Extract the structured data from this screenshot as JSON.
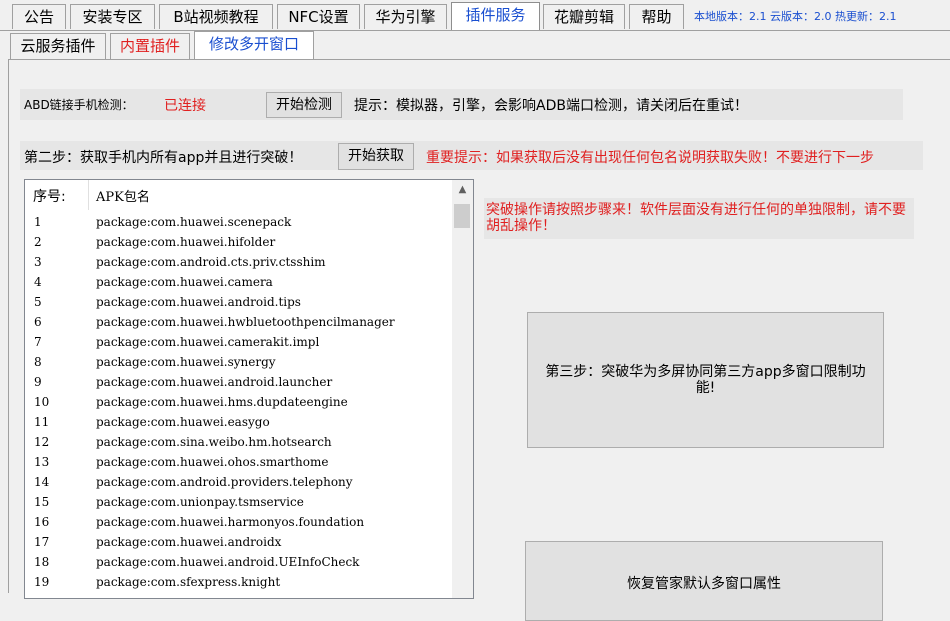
{
  "tabs": [
    {
      "label": "公告"
    },
    {
      "label": "安装专区"
    },
    {
      "label": "B站视频教程"
    },
    {
      "label": "NFC设置"
    },
    {
      "label": "华为引擎"
    },
    {
      "label": "插件服务",
      "active": true
    },
    {
      "label": "花瓣剪辑"
    },
    {
      "label": "帮助"
    }
  ],
  "version_info": "本地版本：2.1   云版本：2.0 热更新：2.1",
  "subtabs": [
    {
      "label": "云服务插件"
    },
    {
      "label": "内置插件"
    },
    {
      "label": "修改多开窗口",
      "active": true
    }
  ],
  "adb": {
    "label": "ABD链接手机检测：",
    "status": "已连接",
    "button": "开始检测",
    "hint": "提示：模拟器，引擎，会影响ADB端口检测，请关闭后在重试！"
  },
  "step2": {
    "label": "第二步：获取手机内所有app并且进行突破！",
    "button": "开始获取",
    "important": "重要提示：如果获取后没有出现任何包名说明获取失败！不要进行下一步"
  },
  "list": {
    "col_index": "序号:",
    "col_pkg": "APK包名",
    "items": [
      {
        "idx": "1",
        "pkg": "package:com.huawei.scenepack"
      },
      {
        "idx": "2",
        "pkg": "package:com.huawei.hifolder"
      },
      {
        "idx": "3",
        "pkg": "package:com.android.cts.priv.ctsshim"
      },
      {
        "idx": "4",
        "pkg": "package:com.huawei.camera"
      },
      {
        "idx": "5",
        "pkg": "package:com.huawei.android.tips"
      },
      {
        "idx": "6",
        "pkg": "package:com.huawei.hwbluetoothpencilmanager"
      },
      {
        "idx": "7",
        "pkg": "package:com.huawei.camerakit.impl"
      },
      {
        "idx": "8",
        "pkg": "package:com.huawei.synergy"
      },
      {
        "idx": "9",
        "pkg": "package:com.huawei.android.launcher"
      },
      {
        "idx": "10",
        "pkg": "package:com.huawei.hms.dupdateengine"
      },
      {
        "idx": "11",
        "pkg": "package:com.huawei.easygo"
      },
      {
        "idx": "12",
        "pkg": "package:com.sina.weibo.hm.hotsearch"
      },
      {
        "idx": "13",
        "pkg": "package:com.huawei.ohos.smarthome"
      },
      {
        "idx": "14",
        "pkg": "package:com.android.providers.telephony"
      },
      {
        "idx": "15",
        "pkg": "package:com.unionpay.tsmservice"
      },
      {
        "idx": "16",
        "pkg": "package:com.huawei.harmonyos.foundation"
      },
      {
        "idx": "17",
        "pkg": "package:com.huawei.androidx"
      },
      {
        "idx": "18",
        "pkg": "package:com.huawei.android.UEInfoCheck"
      },
      {
        "idx": "19",
        "pkg": "package:com.sfexpress.knight"
      }
    ]
  },
  "warning": "突破操作请按照步骤来！软件层面没有进行任何的单独限制，请不要胡乱操作！",
  "step3_button": "第三步：突破华为多屏协同第三方app多窗口限制功能!",
  "restore_button": "恢复管家默认多窗口属性",
  "icons": {
    "scroll_up": "chevron-up-icon"
  }
}
